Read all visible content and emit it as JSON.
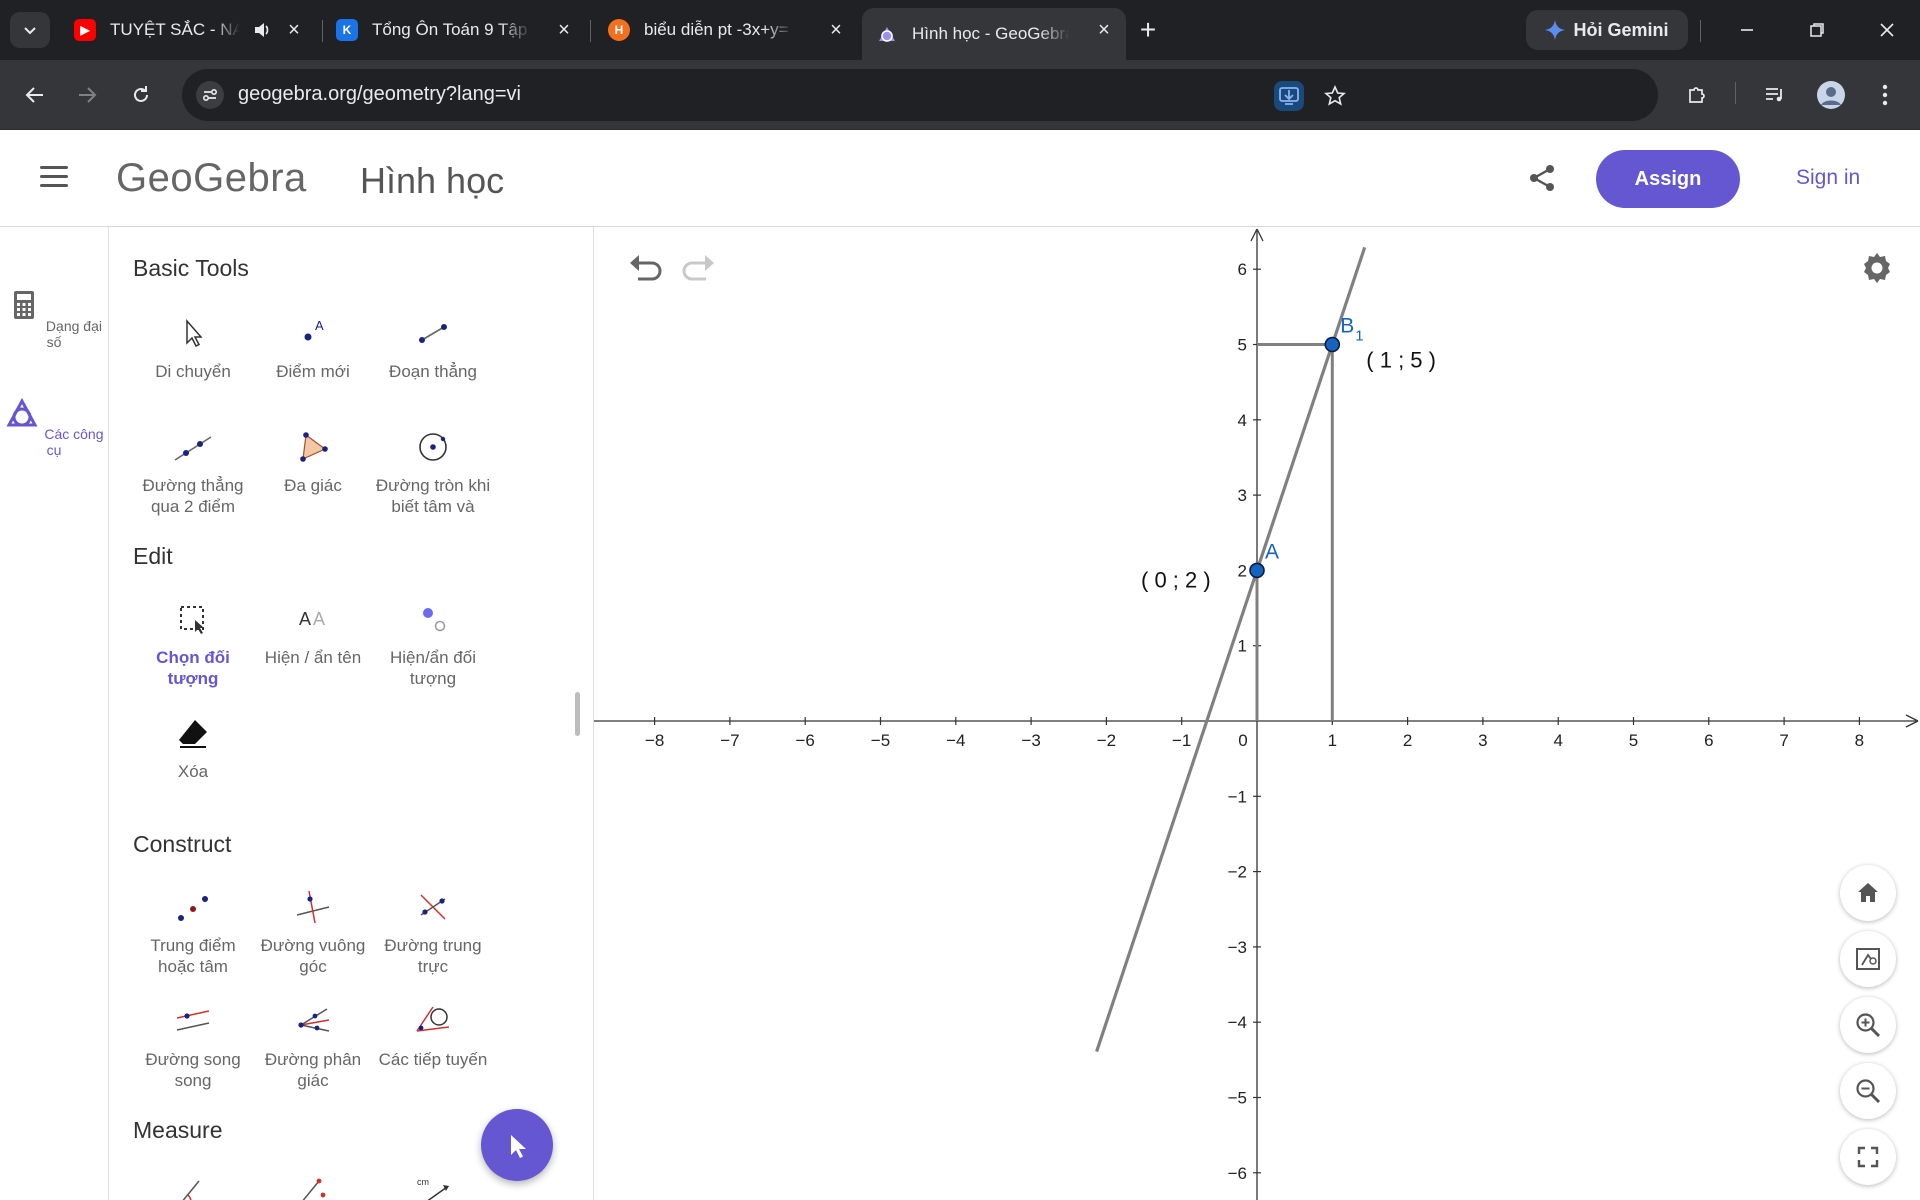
{
  "browser": {
    "tabs": [
      {
        "title": "TUYỆT SẮC - NA",
        "favicon": "youtube-icon",
        "color": "#ff0000",
        "audio": true
      },
      {
        "title": "Tổng Ôn Toán 9 Tập",
        "favicon": "k-logo-icon",
        "color": "#1a73e8"
      },
      {
        "title": "biểu diễn pt -3x+y=",
        "favicon": "h-logo-icon",
        "color": "#f37021"
      },
      {
        "title": "Hình học - GeoGebra",
        "favicon": "geogebra-icon",
        "color": "#6557d2",
        "active": true
      }
    ],
    "gemini_label": "Hỏi Gemini",
    "url": "geogebra.org/geometry?lang=vi"
  },
  "header": {
    "logo": "GeoGebra",
    "app_title": "Hình học",
    "assign_label": "Assign",
    "signin_label": "Sign in"
  },
  "rail": {
    "items": [
      {
        "label": "Dạng đại số",
        "icon": "calculator-icon"
      },
      {
        "label": "Các công cụ",
        "icon": "tools-icon",
        "active": true
      }
    ]
  },
  "tools": {
    "sections": [
      {
        "title": "Basic Tools"
      },
      {
        "title": "Edit"
      },
      {
        "title": "Construct"
      },
      {
        "title": "Measure"
      }
    ],
    "basic": [
      {
        "label": "Di chuyển",
        "icon": "move-icon"
      },
      {
        "label": "Điểm mới",
        "icon": "point-icon"
      },
      {
        "label": "Đoạn thẳng",
        "icon": "segment-icon"
      },
      {
        "label": "Đường thẳng qua 2 điểm",
        "icon": "line-icon"
      },
      {
        "label": "Đa giác",
        "icon": "polygon-icon"
      },
      {
        "label": "Đường tròn khi biết tâm và",
        "icon": "circle-icon"
      }
    ],
    "edit": [
      {
        "label": "Chọn đối tượng",
        "icon": "select-icon",
        "selected": true
      },
      {
        "label": "Hiện / ẩn tên",
        "icon": "show-label-icon"
      },
      {
        "label": "Hiện/ẩn đối tượng",
        "icon": "show-object-icon"
      },
      {
        "label": "Xóa",
        "icon": "eraser-icon"
      }
    ],
    "construct": [
      {
        "label": "Trung điểm hoặc tâm",
        "icon": "midpoint-icon"
      },
      {
        "label": "Đường vuông góc",
        "icon": "perpendicular-icon"
      },
      {
        "label": "Đường trung trực",
        "icon": "bisector-icon"
      },
      {
        "label": "Đường song song",
        "icon": "parallel-icon"
      },
      {
        "label": "Đường phân giác",
        "icon": "angle-bisector-icon"
      },
      {
        "label": "Các tiếp tuyến",
        "icon": "tangent-icon"
      }
    ]
  },
  "graphics": {
    "x_ticks": [
      -8,
      -7,
      -6,
      -5,
      -4,
      -3,
      -2,
      -1,
      0,
      1,
      2,
      3,
      4,
      5,
      6,
      7,
      8
    ],
    "y_ticks": [
      -6,
      -5,
      -4,
      -3,
      -2,
      -1,
      1,
      2,
      3,
      4,
      5,
      6
    ],
    "points": [
      {
        "name": "A",
        "x": 0,
        "y": 2,
        "label": "( 0 ; 2 )"
      },
      {
        "name": "B",
        "subscript": "1",
        "x": 1,
        "y": 5,
        "label": "( 1 ; 5 )"
      }
    ],
    "line": {
      "slope": 3,
      "intercept": 2
    },
    "colors": {
      "accent": "#6557d2",
      "point": "#1565c0",
      "line": "#808080"
    }
  }
}
